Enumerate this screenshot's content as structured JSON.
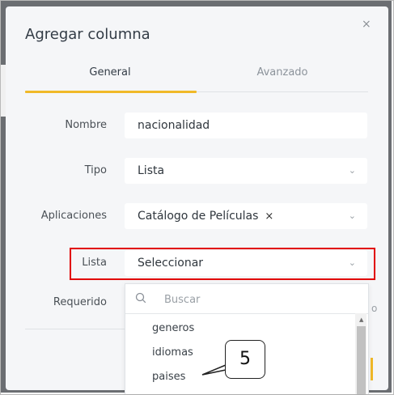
{
  "dialog": {
    "title": "Agregar columna",
    "close": "×"
  },
  "tabs": [
    {
      "label": "General",
      "active": true
    },
    {
      "label": "Avanzado",
      "active": false
    }
  ],
  "form": {
    "nombre": {
      "label": "Nombre",
      "value": "nacionalidad"
    },
    "tipo": {
      "label": "Tipo",
      "value": "Lista"
    },
    "aplicaciones": {
      "label": "Aplicaciones",
      "value": "Catálogo de Películas",
      "remove": "×"
    },
    "lista": {
      "label": "Lista",
      "value": "Seleccionar"
    },
    "requerido": {
      "label": "Requerido"
    }
  },
  "dropdown": {
    "search_placeholder": "Buscar",
    "options": [
      "generos",
      "idiomas",
      "paises"
    ]
  },
  "callout": {
    "number": "5"
  },
  "icons": {
    "close": "close-icon",
    "chevron": "chevron-down-icon",
    "search": "search-icon",
    "tag_remove": "close-icon"
  },
  "colors": {
    "accent": "#f0b929",
    "highlight": "#e10000",
    "backdrop": "#6b6e72"
  }
}
